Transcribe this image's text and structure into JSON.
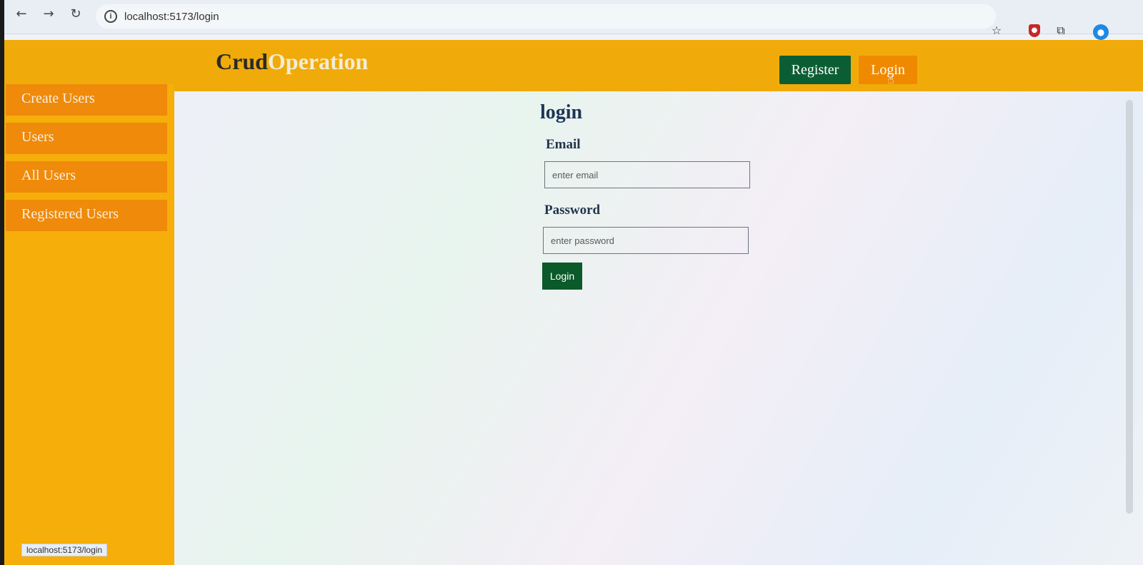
{
  "browser": {
    "url": "localhost:5173/login",
    "status_url": "localhost:5173/login",
    "icons": [
      "back-arrow-icon",
      "forward-arrow-icon",
      "reload-icon",
      "info-icon",
      "star-icon",
      "shield-icon",
      "extensions-icon",
      "profile-icon"
    ]
  },
  "header": {
    "brand_part1": "Crud",
    "brand_part2": "Operation",
    "register_label": "Register",
    "login_label": "Login"
  },
  "sidebar": {
    "items": [
      {
        "label": "Create Users"
      },
      {
        "label": "Users"
      },
      {
        "label": "All Users"
      },
      {
        "label": "Registered Users"
      }
    ]
  },
  "form": {
    "title": "login",
    "email_label": "Email",
    "email_placeholder": "enter email",
    "password_label": "Password",
    "password_placeholder": "enter password",
    "submit_label": "Login"
  },
  "colors": {
    "header_bg": "#f0ab0a",
    "sidebar_item_bg": "#ef8a0a",
    "register_button": "#0b5e33",
    "login_button": "#ef8a00",
    "submit_button": "#0a5a2a"
  }
}
